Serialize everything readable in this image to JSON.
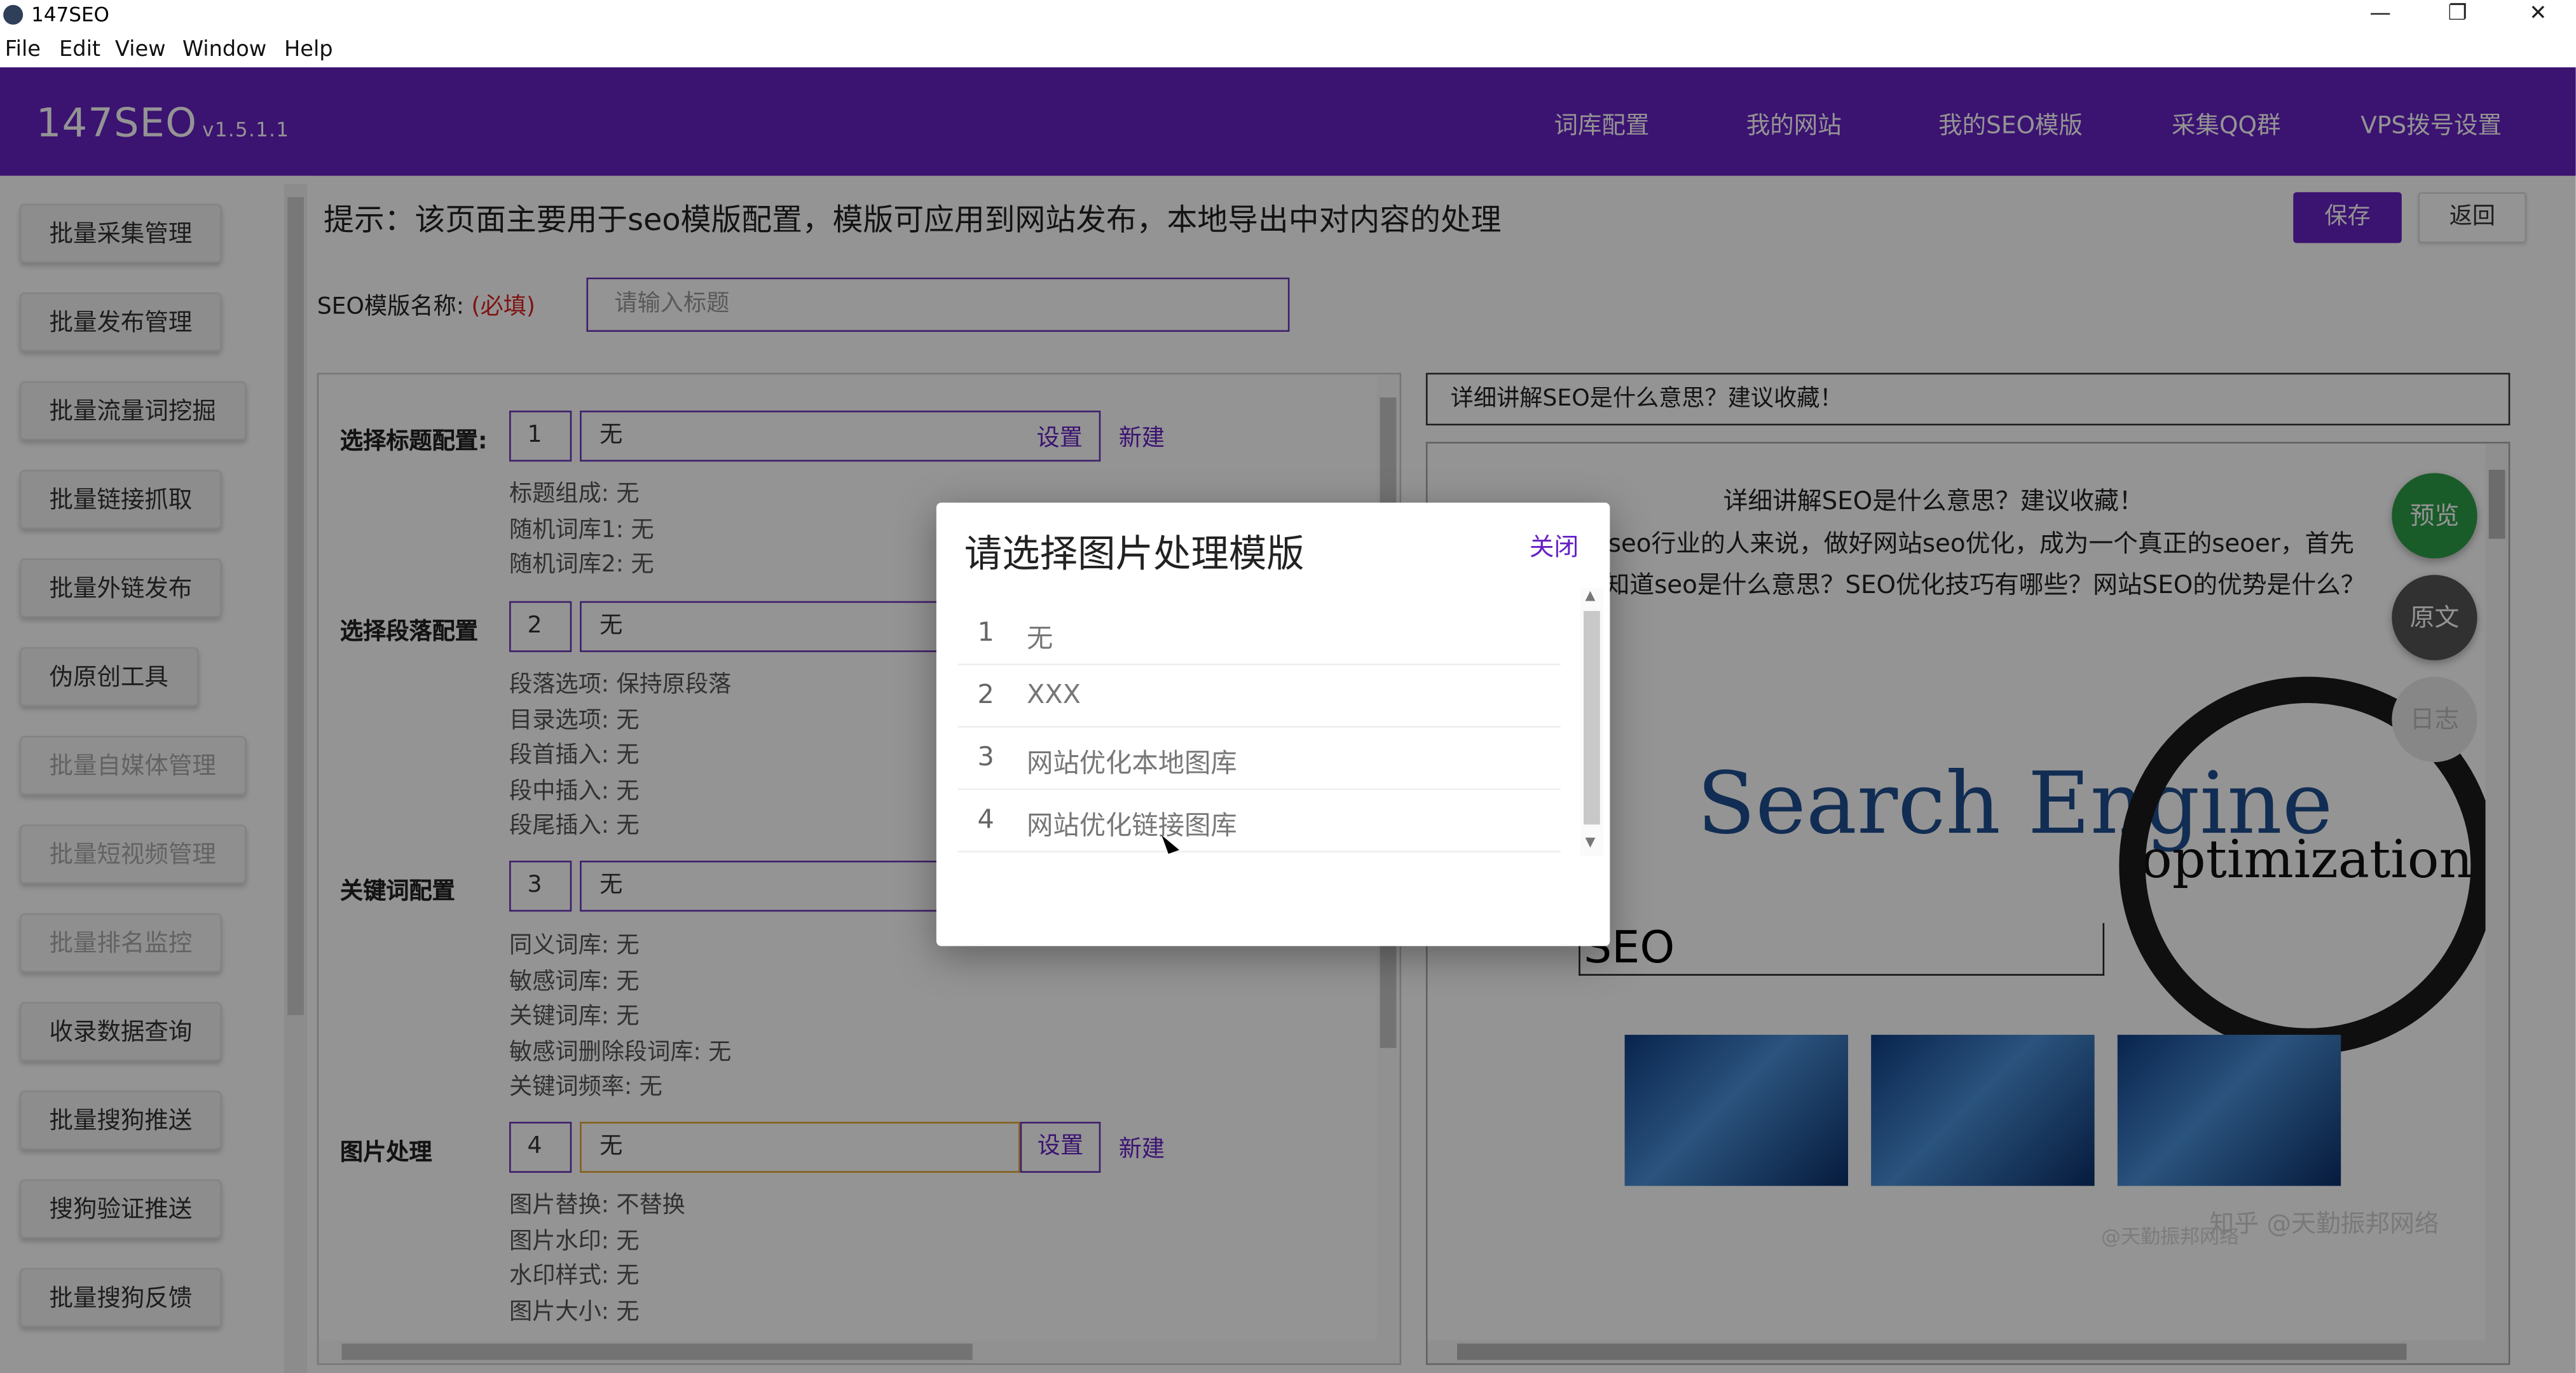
{
  "window": {
    "title": "147SEO",
    "minimize_glyph": "—",
    "maximize_glyph": "❐",
    "close_glyph": "✕"
  },
  "menu": [
    "File",
    "Edit",
    "View",
    "Window",
    "Help"
  ],
  "header": {
    "brand": "147SEO",
    "version": "v1.5.1.1",
    "nav": [
      "词库配置",
      "我的网站",
      "我的SEO模版",
      "采集QQ群",
      "VPS拨号设置"
    ]
  },
  "sidebar": {
    "items": [
      {
        "label": "批量采集管理"
      },
      {
        "label": "批量发布管理"
      },
      {
        "label": "批量流量词挖掘"
      },
      {
        "label": "批量链接抓取"
      },
      {
        "label": "批量外链发布"
      },
      {
        "label": "伪原创工具"
      },
      {
        "label": "批量自媒体管理"
      },
      {
        "label": "批量短视频管理"
      },
      {
        "label": "批量排名监控"
      },
      {
        "label": "收录数据查询"
      },
      {
        "label": "批量搜狗推送"
      },
      {
        "label": "搜狗验证推送"
      },
      {
        "label": "批量搜狗反馈"
      }
    ]
  },
  "main": {
    "tip": "提示：该页面主要用于seo模版配置，模版可应用到网站发布，本地导出中对内容的处理",
    "save_label": "保存",
    "back_label": "返回",
    "seo_name_label": "SEO模版名称:",
    "seo_name_required": "(必填)",
    "seo_name_placeholder": "请输入标题",
    "sections": [
      {
        "label": "选择标题配置:",
        "num": "1",
        "value": "无",
        "set_label": "设置",
        "new_label": "新建",
        "info": [
          "标题组成: 无",
          "随机词库1: 无",
          "随机词库2: 无"
        ]
      },
      {
        "label": "选择段落配置",
        "num": "2",
        "value": "无",
        "info": [
          "段落选项: 保持原段落",
          "目录选项: 无",
          "段首插入: 无",
          "段中插入: 无",
          "段尾插入: 无"
        ]
      },
      {
        "label": "关键词配置",
        "num": "3",
        "value": "无",
        "info": [
          "同义词库: 无",
          "敏感词库: 无",
          "关键词库: 无",
          "敏感词删除段词库: 无",
          "关键词频率: 无"
        ]
      },
      {
        "label": "图片处理",
        "num": "4",
        "value": "无",
        "set_label": "设置",
        "new_label": "新建",
        "info": [
          "图片替换: 不替换",
          "图片水印: 无",
          "水印样式: 无",
          "图片大小: 无"
        ]
      }
    ]
  },
  "preview": {
    "title_bar": "详细讲解SEO是什么意思？建议收藏！",
    "article_title": "详细讲解SEO是什么意思？建议收藏！",
    "article_lines": [
      "seo行业的人来说，做好网站seo优化，成为一个真正的seoer，首先",
      "知道seo是什么意思？SEO优化技巧有哪些？网站SEO的优势是什么？"
    ],
    "image_text_1": "Search Engine",
    "image_text_2": "optimization",
    "image_text_seo": "SEO",
    "watermark": "知乎 @天勤振邦网络",
    "watermark_small": "@天勤振邦网络",
    "fab_preview": "预览",
    "fab_original": "原文",
    "fab_log": "日志"
  },
  "modal": {
    "title": "请选择图片处理模版",
    "close_label": "关闭",
    "items": [
      {
        "index": "1",
        "name": "无"
      },
      {
        "index": "2",
        "name": "XXX"
      },
      {
        "index": "3",
        "name": "网站优化本地图库"
      },
      {
        "index": "4",
        "name": "网站优化链接图库"
      }
    ]
  },
  "colors": {
    "brand_purple": "#6621c3",
    "required_red": "#d22222",
    "orange_focus": "#e3a52d",
    "preview_green": "#2e9e49"
  }
}
